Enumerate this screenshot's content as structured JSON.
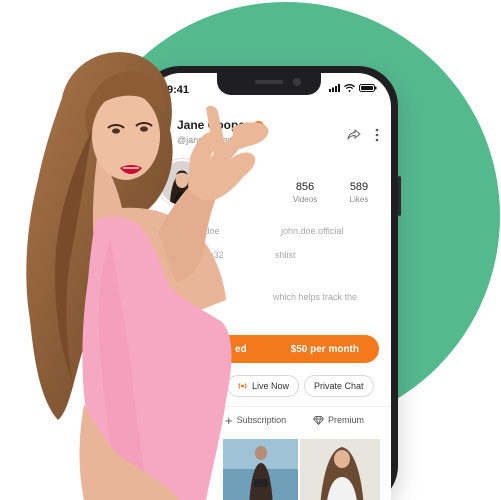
{
  "status_bar": {
    "time": "9:41",
    "icons": [
      "signal-icon",
      "wifi-icon",
      "battery-icon"
    ]
  },
  "profile": {
    "name": "Jane Cooper",
    "handle": "@janecooper",
    "verified": true,
    "online": true,
    "stats": [
      {
        "value": "856",
        "label": "Videos"
      },
      {
        "value": "589",
        "label": "Likes"
      }
    ],
    "details": {
      "link_1": "ohn.doe",
      "link_2": "john.doe.official",
      "item_1": "Joe32",
      "item_2": "shlist",
      "bio_fragment": "which helps track the"
    }
  },
  "subscribe": {
    "label": "ed",
    "price": "$50 per month"
  },
  "chips": [
    {
      "label": "Live Now",
      "icon": "live-icon"
    },
    {
      "label": "Private Chat",
      "icon": ""
    }
  ],
  "tabs": [
    {
      "label": "Subscription",
      "icon": "plus-icon"
    },
    {
      "label": "Premium",
      "icon": "diamond-icon"
    }
  ],
  "colors": {
    "background_circle": "#55b98e",
    "accent": "#f4781c",
    "online": "#3ec46d",
    "live": "#f06a1a"
  }
}
